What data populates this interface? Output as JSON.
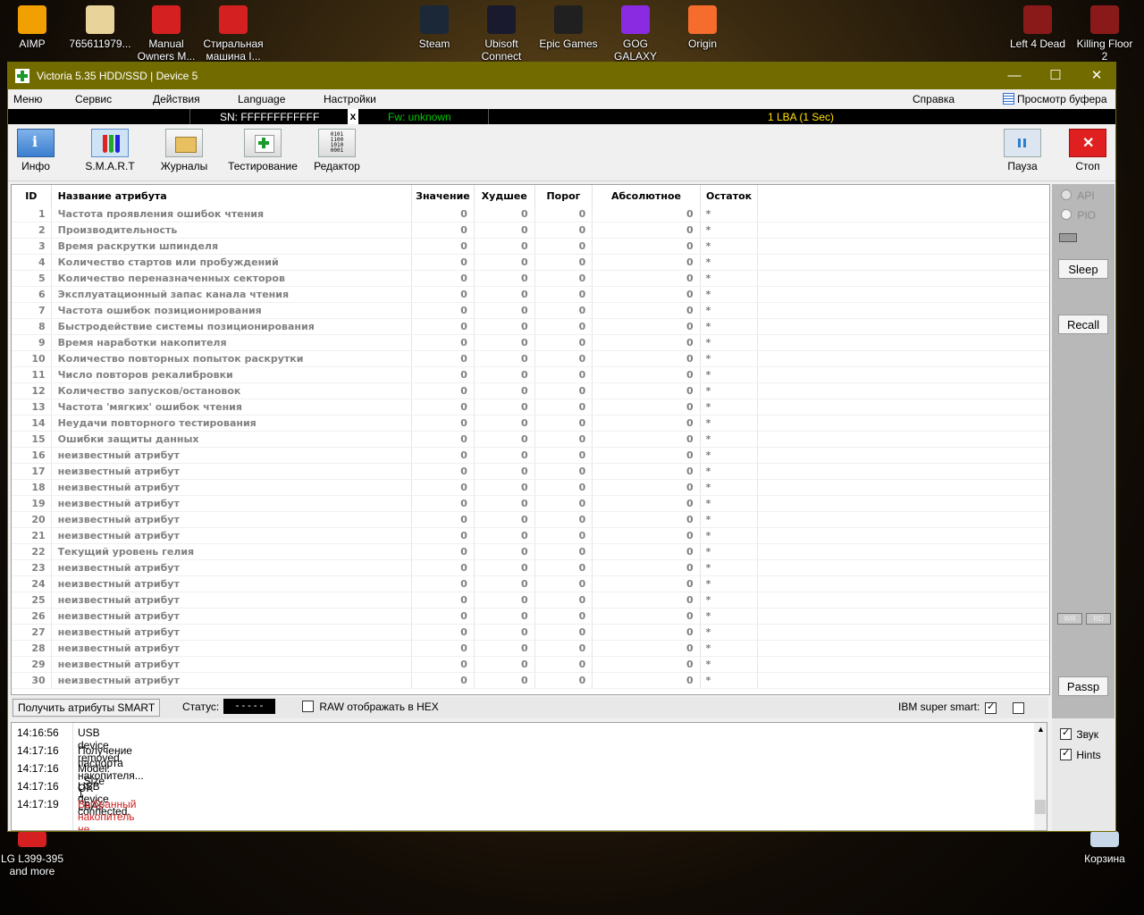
{
  "desktop": {
    "icons_top": [
      {
        "label": "AIMP",
        "color": "#f0a000"
      },
      {
        "label": "765611979...",
        "color": "#e8d39a"
      },
      {
        "label": "Manual Owners M...",
        "color": "#d42020"
      },
      {
        "label": "Стиральная машина I...",
        "color": "#d42020"
      },
      {
        "label": "Steam",
        "color": "#1b2838"
      },
      {
        "label": "Ubisoft Connect",
        "color": "#1a1a2e"
      },
      {
        "label": "Epic Games",
        "color": "#202020"
      },
      {
        "label": "GOG GALAXY",
        "color": "#8a2be2"
      },
      {
        "label": "Origin",
        "color": "#f56c2d"
      },
      {
        "label": "Left 4 Dead",
        "color": "#8a1a1a"
      },
      {
        "label": "Killing Floor 2",
        "color": "#8a1a1a"
      }
    ],
    "icons_bottom": [
      {
        "label": "LG L399-395 and more",
        "color": "#d42020"
      },
      {
        "label": "Корзина",
        "color": "#c8d8e8"
      }
    ]
  },
  "window": {
    "title": "Victoria 5.35 HDD/SSD | Device 5",
    "minimize": "—",
    "maximize": "☐",
    "close": "✕"
  },
  "menu": {
    "items": [
      "Меню",
      "Сервис",
      "Действия",
      "Language",
      "Настройки"
    ],
    "help": "Справка",
    "buffer": "Просмотр буфера"
  },
  "strip": {
    "sn": "SN: FFFFFFFFFFFF",
    "x": "x",
    "fw": "Fw: unknown",
    "lba": "1 LBA (1 Sec)"
  },
  "toolbar": {
    "left": [
      "Инфо",
      "S.M.A.R.T",
      "Журналы",
      "Тестирование",
      "Редактор"
    ],
    "pause": "Пауза",
    "stop": "Стоп"
  },
  "smart": {
    "columns": [
      "ID",
      "Название атрибута",
      "Значение",
      "Худшее",
      "Порог",
      "Абсолютное",
      "Остаток"
    ],
    "rows": [
      [
        "1",
        "Частота проявления ошибок чтения",
        "0",
        "0",
        "0",
        "0",
        "*"
      ],
      [
        "2",
        "Производительность",
        "0",
        "0",
        "0",
        "0",
        "*"
      ],
      [
        "3",
        "Время раскрутки шпинделя",
        "0",
        "0",
        "0",
        "0",
        "*"
      ],
      [
        "4",
        "Количество стартов или пробуждений",
        "0",
        "0",
        "0",
        "0",
        "*"
      ],
      [
        "5",
        "Количество переназначенных секторов",
        "0",
        "0",
        "0",
        "0",
        "*"
      ],
      [
        "6",
        "Эксплуатационный запас канала чтения",
        "0",
        "0",
        "0",
        "0",
        "*"
      ],
      [
        "7",
        "Частота ошибок позиционирования",
        "0",
        "0",
        "0",
        "0",
        "*"
      ],
      [
        "8",
        "Быстродействие системы позиционирования",
        "0",
        "0",
        "0",
        "0",
        "*"
      ],
      [
        "9",
        "Время наработки накопителя",
        "0",
        "0",
        "0",
        "0",
        "*"
      ],
      [
        "10",
        "Количество повторных попыток раскрутки",
        "0",
        "0",
        "0",
        "0",
        "*"
      ],
      [
        "11",
        "Число повторов рекалибровки",
        "0",
        "0",
        "0",
        "0",
        "*"
      ],
      [
        "12",
        "Количество запусков/остановок",
        "0",
        "0",
        "0",
        "0",
        "*"
      ],
      [
        "13",
        "Частота 'мягких' ошибок чтения",
        "0",
        "0",
        "0",
        "0",
        "*"
      ],
      [
        "14",
        "Неудачи повторного тестирования",
        "0",
        "0",
        "0",
        "0",
        "*"
      ],
      [
        "15",
        "Ошибки защиты данных",
        "0",
        "0",
        "0",
        "0",
        "*"
      ],
      [
        "16",
        "неизвестный атрибут",
        "0",
        "0",
        "0",
        "0",
        "*"
      ],
      [
        "17",
        "неизвестный атрибут",
        "0",
        "0",
        "0",
        "0",
        "*"
      ],
      [
        "18",
        "неизвестный атрибут",
        "0",
        "0",
        "0",
        "0",
        "*"
      ],
      [
        "19",
        "неизвестный атрибут",
        "0",
        "0",
        "0",
        "0",
        "*"
      ],
      [
        "20",
        "неизвестный атрибут",
        "0",
        "0",
        "0",
        "0",
        "*"
      ],
      [
        "21",
        "неизвестный атрибут",
        "0",
        "0",
        "0",
        "0",
        "*"
      ],
      [
        "22",
        "Текущий уровень гелия",
        "0",
        "0",
        "0",
        "0",
        "*"
      ],
      [
        "23",
        "неизвестный атрибут",
        "0",
        "0",
        "0",
        "0",
        "*"
      ],
      [
        "24",
        "неизвестный атрибут",
        "0",
        "0",
        "0",
        "0",
        "*"
      ],
      [
        "25",
        "неизвестный атрибут",
        "0",
        "0",
        "0",
        "0",
        "*"
      ],
      [
        "26",
        "неизвестный атрибут",
        "0",
        "0",
        "0",
        "0",
        "*"
      ],
      [
        "27",
        "неизвестный атрибут",
        "0",
        "0",
        "0",
        "0",
        "*"
      ],
      [
        "28",
        "неизвестный атрибут",
        "0",
        "0",
        "0",
        "0",
        "*"
      ],
      [
        "29",
        "неизвестный атрибут",
        "0",
        "0",
        "0",
        "0",
        "*"
      ],
      [
        "30",
        "неизвестный атрибут",
        "0",
        "0",
        "0",
        "0",
        "*"
      ]
    ]
  },
  "bottom": {
    "get_smart": "Получить атрибуты SMART",
    "status_label": "Статус:",
    "status_value": "- - - - -",
    "raw_hex": "RAW отображать в HEX",
    "ibm": "IBM super smart:"
  },
  "side": {
    "api": "API",
    "pio": "PIO",
    "sleep": "Sleep",
    "recall": "Recall",
    "wr": "WR",
    "rd": "RD",
    "passp": "Passp",
    "sound": "Звук",
    "hints": "Hints"
  },
  "log": [
    {
      "time": "14:16:56",
      "msg": "USB device removed.",
      "color": "#000000"
    },
    {
      "time": "14:17:16",
      "msg": "Получение паспорта накопителя... OK",
      "color": "#000000"
    },
    {
      "time": "14:17:16",
      "msg": "Model:  ; Size 1 LBAs",
      "color": "#000000"
    },
    {
      "time": "14:17:16",
      "msg": "USB device connected.",
      "color": "#000000"
    },
    {
      "time": "14:17:19",
      "msg": "Выбранный накопитель не поддерживает технологию S.M.A.R.T.",
      "color": "#d02020"
    }
  ],
  "colors": {
    "titlebar": "#726c00",
    "fw": "#00c800",
    "lba": "#ffe000"
  }
}
